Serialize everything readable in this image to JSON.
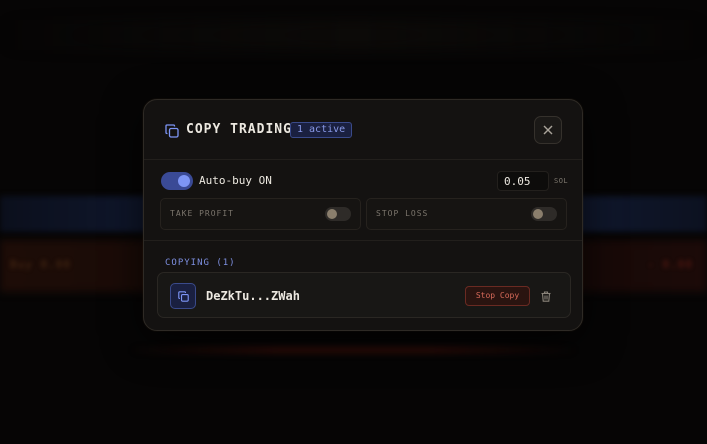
{
  "background": {
    "left_text": "Buy 0.00",
    "right_text": "- 0.00"
  },
  "modal": {
    "title": "COPY TRADING",
    "active_badge": "1 active",
    "accent_color": "#7d95f5",
    "danger_color": "#d86a5a"
  },
  "settings": {
    "autobuy_label": "Auto-buy ON",
    "autobuy_enabled": true,
    "amount_value": "0.05",
    "amount_unit": "SOL",
    "take_profit_label": "TAKE PROFIT",
    "take_profit_enabled": false,
    "stop_loss_label": "STOP LOSS",
    "stop_loss_enabled": false
  },
  "copying": {
    "section_label": "COPYING (1)",
    "wallets": [
      {
        "address": "DeZkTu...ZWah",
        "stop_label": "Stop Copy"
      }
    ]
  }
}
